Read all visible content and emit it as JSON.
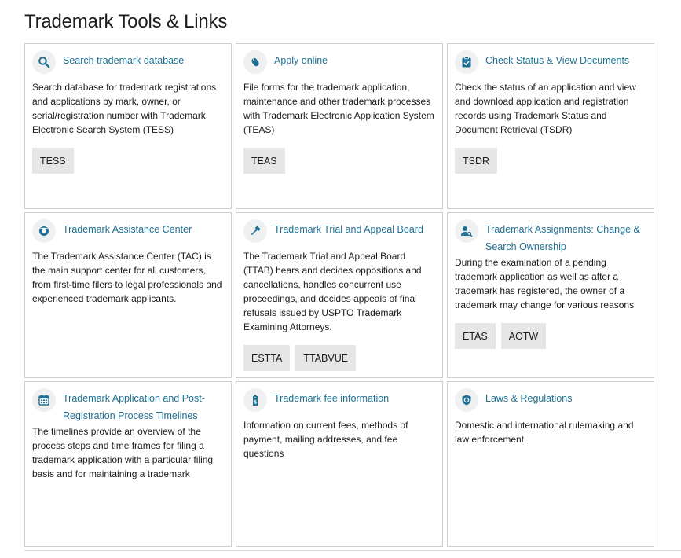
{
  "page": {
    "title": "Trademark Tools & Links"
  },
  "cards": [
    {
      "icon": "search-icon",
      "title": "Search trademark database",
      "description": "Search database for trademark registrations and applications by mark, owner, or serial/registration number with Trademark Electronic Search System (TESS)",
      "buttons": [
        "TESS"
      ]
    },
    {
      "icon": "mouse-icon",
      "title": "Apply online",
      "description": "File forms for the trademark application, maintenance and other trademark processes with Trademark Electronic Application System (TEAS)",
      "buttons": [
        "TEAS"
      ]
    },
    {
      "icon": "clipboard-check-icon",
      "title": "Check Status & View Documents",
      "description": "Check the status of an application and view and download application and registration records using Trademark Status and Document Retrieval (TSDR)",
      "buttons": [
        "TSDR"
      ]
    },
    {
      "icon": "life-ring-icon",
      "title": "Trademark Assistance Center",
      "description": "The Trademark Assistance Center (TAC) is the main support center for all customers, from first-time filers to legal professionals and experienced trademark applicants.",
      "buttons": []
    },
    {
      "icon": "gavel-icon",
      "title": "Trademark Trial and Appeal Board",
      "description": "The Trademark Trial and Appeal Board (TTAB) hears and decides oppositions and cancellations, handles concurrent use proceedings, and decides appeals of final refusals issued by USPTO Trademark Examining Attorneys.",
      "buttons": [
        "ESTTA",
        "TTABVUE"
      ]
    },
    {
      "icon": "user-search-icon",
      "title": "Trademark Assignments: Change & Search Ownership",
      "description": "During the examination of a pending trademark application as well as after a trademark has registered, the owner of a trademark may change for various reasons",
      "buttons": [
        "ETAS",
        "AOTW"
      ]
    },
    {
      "icon": "calendar-icon",
      "title": "Trademark Application and Post-Registration Process Timelines",
      "description": "The timelines provide an overview of the process steps and time frames for filing a trademark application with a particular filing basis and for maintaining a trademark",
      "buttons": []
    },
    {
      "icon": "fee-tag-icon",
      "title": "Trademark fee information",
      "description": "Information on current fees, methods of payment, mailing addresses, and fee questions",
      "buttons": []
    },
    {
      "icon": "badge-icon",
      "title": "Laws & Regulations",
      "description": "Domestic and international rulemaking and law enforcement",
      "buttons": []
    }
  ],
  "colors": {
    "link": "#1f6f92",
    "icon": "#1f6f92",
    "icon_bg": "#eef0f2",
    "button_bg": "#e6e6e6",
    "border": "#cfcfcf"
  }
}
